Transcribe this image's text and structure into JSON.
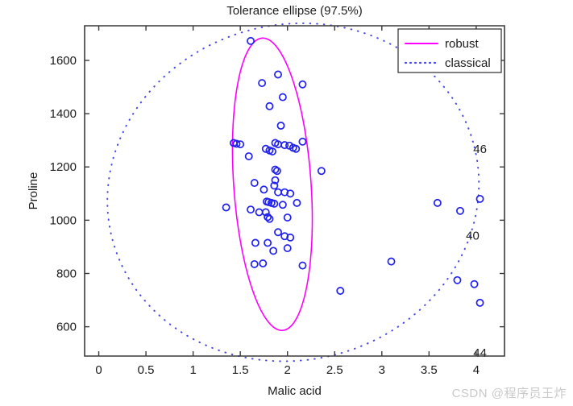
{
  "watermark": "CSDN @程序员王炸",
  "colors": {
    "robust": "#ff00ff",
    "classical": "#4a4ae0",
    "marker": "#2020ef",
    "axis": "#3a3a3a",
    "background": "#ffffff"
  },
  "legend": {
    "position": "top-right",
    "entries": [
      {
        "label": "robust",
        "style": "solid",
        "color": "#ff00ff"
      },
      {
        "label": "classical",
        "style": "dotted",
        "color": "#4a4ae0"
      }
    ]
  },
  "chart_data": {
    "type": "scatter",
    "title": "Tolerance ellipse (97.5%)",
    "xlabel": "Malic acid",
    "ylabel": "Proline",
    "xlim": [
      -0.15,
      4.3
    ],
    "ylim": [
      490,
      1730
    ],
    "xticks": [
      0,
      0.5,
      1,
      1.5,
      2,
      2.5,
      3,
      3.5,
      4
    ],
    "xticklabels": [
      "0",
      "0.5",
      "1",
      "1.5",
      "2",
      "2.5",
      "3",
      "3.5",
      "4"
    ],
    "yticks": [
      600,
      800,
      1000,
      1200,
      1400,
      1600
    ],
    "yticklabels": [
      "600",
      "800",
      "1000",
      "1200",
      "1400",
      "1600"
    ],
    "grid": false,
    "marker": "open-circle",
    "points": [
      {
        "x": 1.61,
        "y": 1673
      },
      {
        "x": 1.9,
        "y": 1547
      },
      {
        "x": 1.73,
        "y": 1515
      },
      {
        "x": 2.16,
        "y": 1510
      },
      {
        "x": 1.95,
        "y": 1462
      },
      {
        "x": 1.81,
        "y": 1428
      },
      {
        "x": 1.93,
        "y": 1355
      },
      {
        "x": 1.87,
        "y": 1290
      },
      {
        "x": 1.9,
        "y": 1285
      },
      {
        "x": 1.97,
        "y": 1282
      },
      {
        "x": 2.02,
        "y": 1280
      },
      {
        "x": 2.06,
        "y": 1272
      },
      {
        "x": 2.09,
        "y": 1268
      },
      {
        "x": 1.43,
        "y": 1290
      },
      {
        "x": 1.46,
        "y": 1287
      },
      {
        "x": 1.5,
        "y": 1285
      },
      {
        "x": 1.77,
        "y": 1268
      },
      {
        "x": 1.81,
        "y": 1262
      },
      {
        "x": 1.84,
        "y": 1258
      },
      {
        "x": 2.16,
        "y": 1295
      },
      {
        "x": 1.59,
        "y": 1240
      },
      {
        "x": 1.87,
        "y": 1190
      },
      {
        "x": 1.89,
        "y": 1185
      },
      {
        "x": 2.36,
        "y": 1185
      },
      {
        "x": 1.87,
        "y": 1150
      },
      {
        "x": 1.65,
        "y": 1140
      },
      {
        "x": 1.86,
        "y": 1130
      },
      {
        "x": 1.75,
        "y": 1115
      },
      {
        "x": 1.9,
        "y": 1105
      },
      {
        "x": 1.97,
        "y": 1105
      },
      {
        "x": 2.03,
        "y": 1100
      },
      {
        "x": 1.35,
        "y": 1048
      },
      {
        "x": 1.78,
        "y": 1070
      },
      {
        "x": 1.8,
        "y": 1068
      },
      {
        "x": 1.83,
        "y": 1065
      },
      {
        "x": 1.86,
        "y": 1062
      },
      {
        "x": 1.95,
        "y": 1058
      },
      {
        "x": 2.1,
        "y": 1065
      },
      {
        "x": 1.61,
        "y": 1040
      },
      {
        "x": 1.7,
        "y": 1030
      },
      {
        "x": 1.77,
        "y": 1030
      },
      {
        "x": 1.79,
        "y": 1012
      },
      {
        "x": 1.81,
        "y": 1005
      },
      {
        "x": 2.0,
        "y": 1010
      },
      {
        "x": 1.9,
        "y": 955
      },
      {
        "x": 1.97,
        "y": 940
      },
      {
        "x": 2.03,
        "y": 935
      },
      {
        "x": 1.66,
        "y": 915
      },
      {
        "x": 1.79,
        "y": 915
      },
      {
        "x": 2.0,
        "y": 895
      },
      {
        "x": 1.85,
        "y": 885
      },
      {
        "x": 2.16,
        "y": 830
      },
      {
        "x": 1.65,
        "y": 835
      },
      {
        "x": 1.74,
        "y": 838
      },
      {
        "x": 2.56,
        "y": 735
      },
      {
        "x": 3.1,
        "y": 845
      },
      {
        "x": 3.59,
        "y": 1065
      },
      {
        "x": 3.83,
        "y": 1035
      },
      {
        "x": 4.04,
        "y": 1080
      },
      {
        "x": 3.8,
        "y": 775
      },
      {
        "x": 3.98,
        "y": 760
      },
      {
        "x": 4.04,
        "y": 690
      }
    ],
    "labeled_outliers": [
      {
        "label": "46",
        "x": 4.04,
        "y": 1080,
        "dx": 0,
        "dy": 62
      },
      {
        "label": "40",
        "x": 3.98,
        "y": 760,
        "dx": -2,
        "dy": 60
      },
      {
        "label": "44",
        "x": 4.04,
        "y": 690,
        "dx": 0,
        "dy": -62
      }
    ],
    "ellipses": [
      {
        "name": "robust",
        "style": "solid",
        "color": "#ff00ff",
        "center_x": 1.84,
        "center_y": 1135,
        "semi_x": 0.41,
        "semi_y": 550,
        "rotation_deg": -4
      },
      {
        "name": "classical",
        "style": "dotted",
        "color": "#4a4ae0",
        "center_x": 2.06,
        "center_y": 1105,
        "semi_x": 1.98,
        "semi_y": 630,
        "rotation_deg": -14
      }
    ]
  }
}
